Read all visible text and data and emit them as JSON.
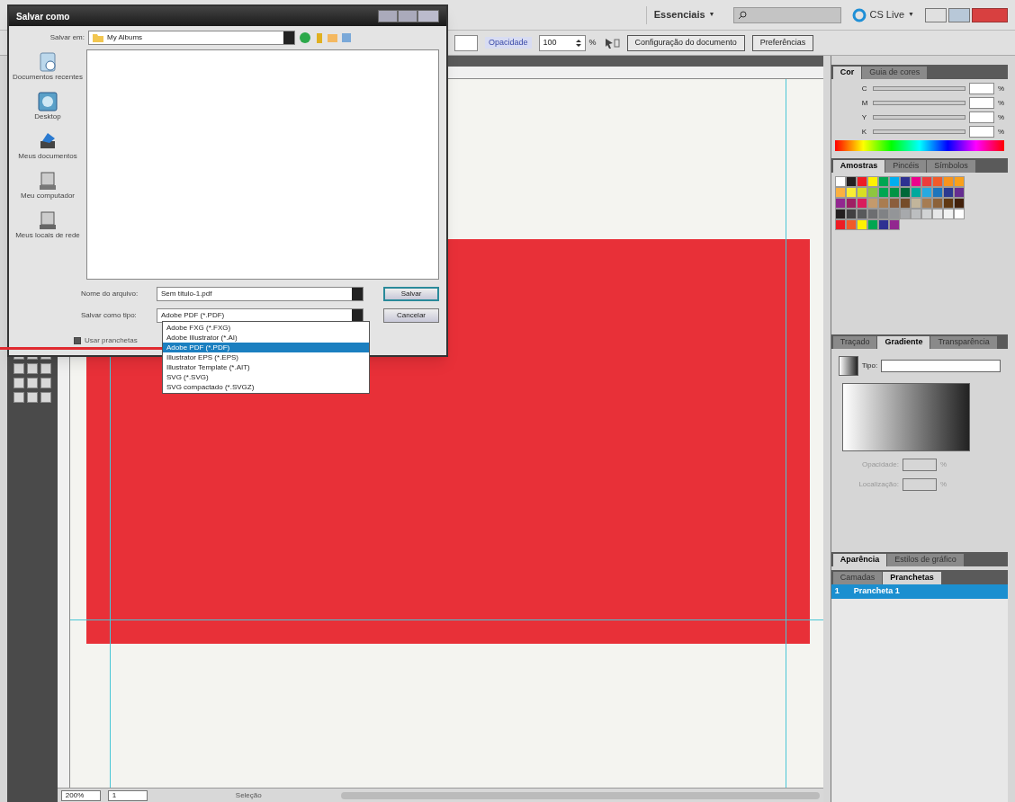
{
  "app_bar": {
    "workspace": "Essenciais",
    "workspace_caret": "▼",
    "cs_live": "CS Live",
    "cs_live_caret": "▼"
  },
  "control_bar": {
    "opacity_label": "Opacidade",
    "opacity_value": "100",
    "percent": "%",
    "buttons": [
      "Configuração do documento",
      "Preferências"
    ]
  },
  "status_bar": {
    "zoom": "200%",
    "artboard": "1",
    "tool": "Seleção"
  },
  "dialog": {
    "title": "Salvar como",
    "save_in_label": "Salvar em:",
    "save_in_value": "My Albums",
    "places": [
      {
        "kind": "recent",
        "label": "Documentos recentes"
      },
      {
        "kind": "desktop",
        "label": "Desktop"
      },
      {
        "kind": "documents",
        "label": "Meus documentos"
      },
      {
        "kind": "computer",
        "label": "Meu computador"
      },
      {
        "kind": "network",
        "label": "Meus locais de rede"
      }
    ],
    "filename_label": "Nome do arquivo:",
    "filename": "Sem título-1.pdf",
    "type_label": "Salvar como tipo:",
    "type_value": "Adobe PDF (*.PDF)",
    "buttons": [
      {
        "label": "Salvar",
        "default": true
      },
      {
        "label": "Cancelar",
        "default": false
      }
    ],
    "use_artboards": {
      "label": "Usar pranchetas",
      "checked": true
    },
    "type_options": [
      {
        "label": "Adobe FXG (*.FXG)",
        "selected": false
      },
      {
        "label": "Adobe Illustrator (*.AI)",
        "selected": false
      },
      {
        "label": "Adobe PDF (*.PDF)",
        "selected": true
      },
      {
        "label": "Illustrator EPS (*.EPS)",
        "selected": false
      },
      {
        "label": "Illustrator Template (*.AIT)",
        "selected": false
      },
      {
        "label": "SVG (*.SVG)",
        "selected": false
      },
      {
        "label": "SVG compactado (*.SVGZ)",
        "selected": false
      }
    ]
  },
  "color_panel": {
    "tabs": [
      {
        "label": "Cor",
        "selected": true
      },
      {
        "label": "Guia de cores",
        "selected": false
      }
    ],
    "channels": [
      {
        "name": "C",
        "unit": "%"
      },
      {
        "name": "M",
        "unit": "%"
      },
      {
        "name": "Y",
        "unit": "%"
      },
      {
        "name": "K",
        "unit": "%"
      }
    ]
  },
  "swatches_panel": {
    "tabs": [
      {
        "label": "Amostras",
        "selected": true
      },
      {
        "label": "Pincéis",
        "selected": false
      },
      {
        "label": "Símbolos",
        "selected": false
      }
    ],
    "swatches": [
      {
        "color": "#ffffff"
      },
      {
        "color": "#231f20"
      },
      {
        "color": "#ed1c24"
      },
      {
        "color": "#fff200"
      },
      {
        "color": "#00a651"
      },
      {
        "color": "#00aeef"
      },
      {
        "color": "#2e3192"
      },
      {
        "color": "#ec008c"
      },
      {
        "color": "#ee3b3b"
      },
      {
        "color": "#f15a29"
      },
      {
        "color": "#f7941d"
      },
      {
        "color": "#f9a01b"
      },
      {
        "color": "#fbb040"
      },
      {
        "color": "#f9ed32"
      },
      {
        "color": "#d7df23"
      },
      {
        "color": "#8dc63f"
      },
      {
        "color": "#00a651"
      },
      {
        "color": "#009444"
      },
      {
        "color": "#006838"
      },
      {
        "color": "#00a99d"
      },
      {
        "color": "#27aae1"
      },
      {
        "color": "#1c75bc"
      },
      {
        "color": "#2b3990"
      },
      {
        "color": "#662d91"
      },
      {
        "color": "#92278f"
      },
      {
        "color": "#9e1f63"
      },
      {
        "color": "#da1c5c"
      },
      {
        "color": "#c49a6c"
      },
      {
        "color": "#a97c50"
      },
      {
        "color": "#8b5e3c"
      },
      {
        "color": "#754c29"
      },
      {
        "color": "#c2b59b"
      },
      {
        "color": "#a67c52"
      },
      {
        "color": "#8c6239"
      },
      {
        "color": "#603913"
      },
      {
        "color": "#42210b"
      },
      {
        "color": "#231f20"
      },
      {
        "color": "#414042"
      },
      {
        "color": "#58595b"
      },
      {
        "color": "#6d6e71"
      },
      {
        "color": "#808285"
      },
      {
        "color": "#939598"
      },
      {
        "color": "#a7a9ac"
      },
      {
        "color": "#bcbec0"
      },
      {
        "color": "#d1d3d4"
      },
      {
        "color": "#e6e7e8"
      },
      {
        "color": "#f1f2f2"
      },
      {
        "color": "#ffffff"
      },
      {
        "color": "#ed1c24"
      },
      {
        "color": "#f15a29"
      },
      {
        "color": "#fff200"
      },
      {
        "color": "#00a651"
      },
      {
        "color": "#2e3192"
      },
      {
        "color": "#92278f"
      }
    ]
  },
  "gradient_panel": {
    "tabs": [
      {
        "label": "Traçado",
        "selected": false
      },
      {
        "label": "Gradiente",
        "selected": true
      },
      {
        "label": "Transparência",
        "selected": false
      }
    ],
    "type_label": "Tipo:",
    "opacity_label": "Opacidade:",
    "location_label": "Localização:",
    "unit": "%"
  },
  "appearance_panel": {
    "tabs": [
      {
        "label": "Aparência",
        "selected": true
      },
      {
        "label": "Estilos de gráfico",
        "selected": false
      }
    ]
  },
  "artboards_panel": {
    "tabs": [
      {
        "label": "Camadas",
        "selected": false
      },
      {
        "label": "Pranchetas",
        "selected": true
      }
    ],
    "rows": [
      {
        "number": "1",
        "name": "Prancheta 1",
        "selected": true
      }
    ]
  }
}
